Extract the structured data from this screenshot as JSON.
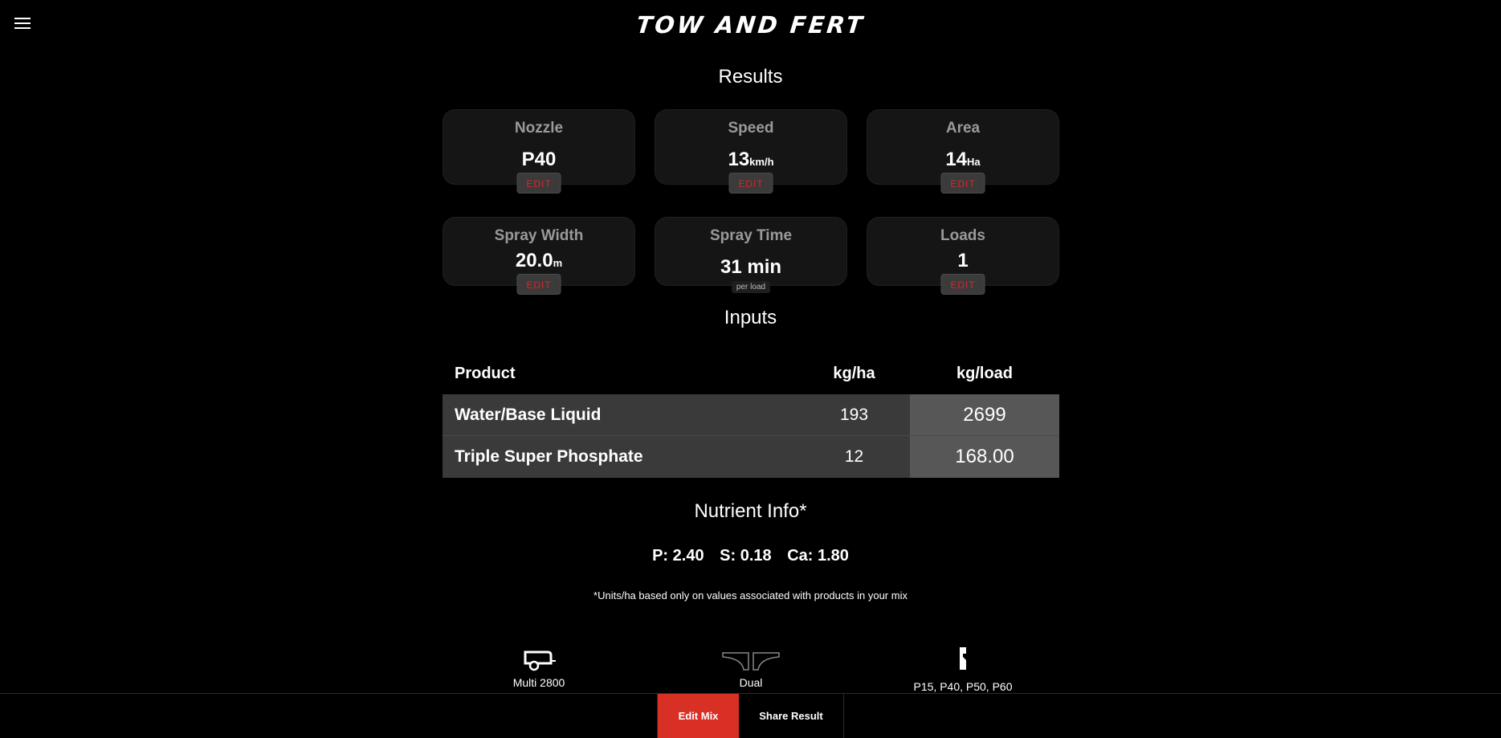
{
  "app": {
    "brand": "TOW AND FERT"
  },
  "results": {
    "title": "Results",
    "edit_label": "EDIT",
    "nozzle": {
      "label": "Nozzle",
      "value": "P40"
    },
    "speed": {
      "label": "Speed",
      "value": "13",
      "unit": "km/h"
    },
    "area": {
      "label": "Area",
      "value": "14",
      "unit": "Ha"
    },
    "spray_width": {
      "label": "Spray Width",
      "value": "20.0",
      "unit": "m"
    },
    "spray_time": {
      "label": "Spray Time",
      "value": "31 min",
      "note": "per load"
    },
    "loads": {
      "label": "Loads",
      "value": "1"
    }
  },
  "inputs": {
    "title": "Inputs",
    "headers": {
      "product": "Product",
      "kg_ha": "kg/ha",
      "kg_load": "kg/load"
    },
    "rows": [
      {
        "product": "Water/Base Liquid",
        "kg_ha": "193",
        "kg_load": "2699"
      },
      {
        "product": "Triple Super Phosphate",
        "kg_ha": "12",
        "kg_load": "168.00"
      }
    ]
  },
  "nutrients": {
    "title": "Nutrient Info*",
    "p": "P: 2.40",
    "s": "S: 0.18",
    "ca": "Ca: 1.80",
    "note": "*Units/ha based only on values associated with products in your mix"
  },
  "equipment": {
    "cart": "Multi 2800",
    "boom": "Dual",
    "nozzles": "P15, P40, P50, P60"
  },
  "bottom_bar": {
    "edit_mix": "Edit Mix",
    "share_result": "Share Result"
  },
  "colors": {
    "accent": "#d93025",
    "card_bg": "#151515",
    "row_bg": "#3a3a3a",
    "load_bg": "#575757"
  }
}
